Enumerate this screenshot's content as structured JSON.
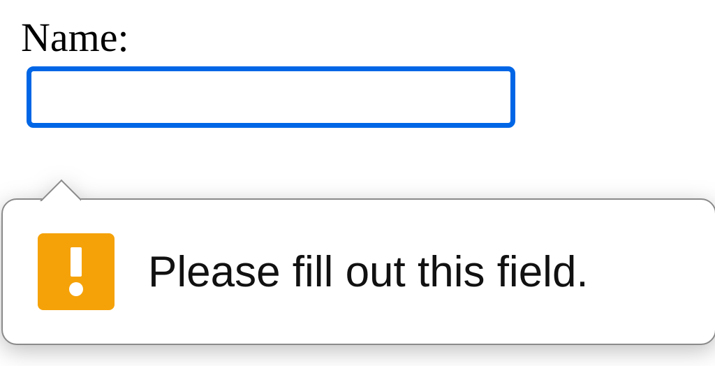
{
  "form": {
    "name_field": {
      "label": "Name:",
      "value": "",
      "placeholder": ""
    }
  },
  "validation": {
    "message": "Please fill out this field.",
    "icon_name": "warning-icon"
  },
  "colors": {
    "focus_border": "#0066e6",
    "warning_bg": "#f5a209",
    "tooltip_border": "#8a8a8a"
  }
}
